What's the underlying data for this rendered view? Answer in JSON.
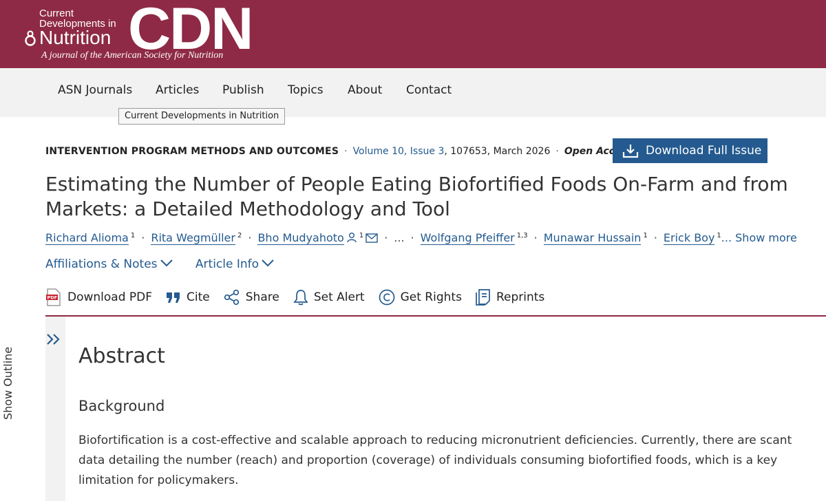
{
  "header": {
    "logo_line1": "Current",
    "logo_line2": "Developments in",
    "logo_nutrition": "Nutrition",
    "logo_cdn": "CDN",
    "tagline": "A journal of the American Society for Nutrition",
    "brand_color": "#8e2a45"
  },
  "nav": {
    "items": [
      "ASN Journals",
      "Articles",
      "Publish",
      "Topics",
      "About",
      "Contact"
    ],
    "tooltip": "Current Developments in Nutrition"
  },
  "meta": {
    "section": "INTERVENTION PROGRAM METHODS AND OUTCOMES",
    "volume": "Volume 10, Issue 3",
    "details": ", 107653, March 2026",
    "access": "Open Access"
  },
  "download_issue": {
    "label": "Download Full Issue",
    "icon": "download-icon"
  },
  "article": {
    "title": "Estimating the Number of People Eating Biofortified Foods On-Farm and from Markets: a Detailed Methodology and Tool"
  },
  "authors": {
    "list": [
      {
        "name": "Richard Alioma",
        "sup": "1"
      },
      {
        "name": "Rita Wegmüller",
        "sup": "2"
      },
      {
        "name": "Bho Mudyahoto",
        "sup": "1"
      },
      {
        "name": "Wolfgang Pfeiffer",
        "sup": "1,3"
      },
      {
        "name": "Munawar Hussain",
        "sup": "1"
      },
      {
        "name": "Erick Boy",
        "sup": "1"
      }
    ],
    "ellipsis": "...",
    "show_more": "... Show more"
  },
  "toggles": {
    "affiliations": "Affiliations & Notes",
    "article_info": "Article Info"
  },
  "actions": {
    "download_pdf": "Download PDF",
    "cite": "Cite",
    "share": "Share",
    "set_alert": "Set Alert",
    "get_rights": "Get Rights",
    "reprints": "Reprints"
  },
  "outline": {
    "label": "Show Outline"
  },
  "abstract": {
    "heading": "Abstract",
    "subheading": "Background",
    "text": "Biofortification is a cost-effective and scalable approach to reducing micronutrient deficiencies. Currently, there are scant data detailing the number (reach) and proportion (coverage) of individuals consuming biofortified foods, which is a key limitation for policymakers."
  }
}
